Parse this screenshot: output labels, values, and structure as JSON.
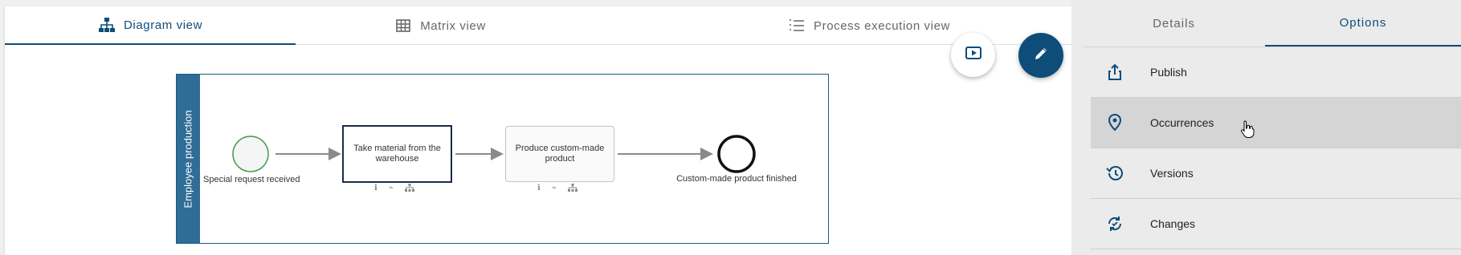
{
  "tabs": [
    {
      "label": "Diagram view",
      "icon": "hierarchy-icon",
      "active": true
    },
    {
      "label": "Matrix view",
      "icon": "grid-icon",
      "active": false
    },
    {
      "label": "Process execution view",
      "icon": "numbered-list-icon",
      "active": false
    }
  ],
  "fab": {
    "play_icon": "play-icon",
    "edit_icon": "pencil-icon"
  },
  "diagram": {
    "lane_label": "Employee production",
    "start_event_label": "Special request received",
    "task1_label": "Take material from the warehouse",
    "task2_label": "Produce custom-made product",
    "end_event_label": "Custom-made product finished",
    "task_attr_icons": [
      "info-icon",
      "attachment-icon",
      "hierarchy-icon"
    ]
  },
  "side": {
    "tabs": [
      {
        "label": "Details",
        "active": false
      },
      {
        "label": "Options",
        "active": true
      }
    ],
    "menu": [
      {
        "label": "Publish",
        "icon": "share-upload-icon"
      },
      {
        "label": "Occurrences",
        "icon": "location-pin-icon",
        "hovered": true
      },
      {
        "label": "Versions",
        "icon": "history-icon"
      },
      {
        "label": "Changes",
        "icon": "sync-changes-icon"
      }
    ]
  },
  "colors": {
    "accent": "#0e4d7a",
    "lane": "#2f6d96",
    "start_event": "#4a9a4a"
  }
}
